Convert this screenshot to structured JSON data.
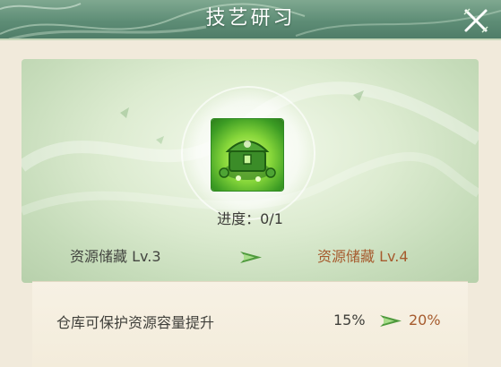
{
  "header": {
    "title": "技艺研习"
  },
  "item": {
    "icon": "treasure-chest-icon"
  },
  "progress": {
    "label": "进度：",
    "value": "0/1"
  },
  "level": {
    "current": "资源储藏 Lv.3",
    "next": "资源储藏 Lv.4"
  },
  "stat": {
    "label": "仓库可保护资源容量提升",
    "current": "15%",
    "next": "20%"
  },
  "colors": {
    "header": "#5e8d76",
    "next_value": "#a65b2e",
    "arrow": "#4f9a3d"
  }
}
